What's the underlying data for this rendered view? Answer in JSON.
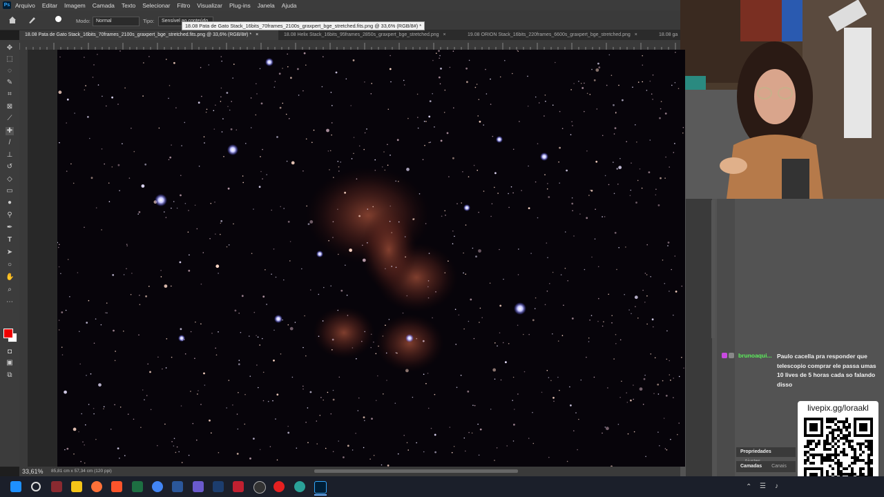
{
  "menubar": {
    "items": [
      "Arquivo",
      "Editar",
      "Imagem",
      "Camada",
      "Texto",
      "Selecionar",
      "Filtro",
      "Visualizar",
      "Plug-ins",
      "Janela",
      "Ajuda"
    ]
  },
  "options": {
    "mode_label": "Modo:",
    "mode_value": "Normal",
    "type_label": "Tipo:",
    "type_value": "Sensível ao conteúdo"
  },
  "tooltip": "18.08 Pata de Gato Stack_16bits_70frames_2100s_graxpert_bge_stretched.fits.png @ 33,6% (RGB/8#) *",
  "tabs": [
    {
      "label": "18.08 Pata de Gato Stack_16bits_70frames_2100s_graxpert_bge_stretched.fits.png @ 33,6% (RGB/8#) *",
      "close": "×",
      "active": true
    },
    {
      "label": "18.08 Helix Stack_16bits_95frames_2850s_graxpert_bge_stretched.png",
      "close": "×",
      "active": false
    },
    {
      "label": "19.08 ORION Stack_16bits_220frames_6600s_graxpert_bge_stretched.png",
      "close": "×",
      "active": false
    },
    {
      "label": "18.08 ga",
      "close": "",
      "active": false
    }
  ],
  "status": {
    "zoom": "33,61%",
    "doc_size": "85,81 cm x 57,34 cm (120 ppi)"
  },
  "chat": {
    "username": "brunoaqui...",
    "message": "Paulo cacella pra responder que telescopio comprar ele passa umas 10 lives de 5 horas cada so falando disso"
  },
  "panels": {
    "props_tab": "Propriedades",
    "adjust_tab": "Ajustes",
    "layers_tab": "Camadas",
    "channels_tab": "Canais"
  },
  "qr": {
    "label": "livepix.gg/loraakl"
  },
  "colors": {
    "foreground": "#e00000",
    "background": "#ffffff",
    "chat_user": "#5cf05c"
  },
  "icons": {
    "toolbar": [
      "move-icon",
      "marquee-icon",
      "lasso-icon",
      "quick-select-icon",
      "crop-icon",
      "frame-icon",
      "eyedropper-icon",
      "healing-icon",
      "brush-icon",
      "clone-stamp-icon",
      "history-brush-icon",
      "eraser-icon",
      "gradient-icon",
      "blur-icon",
      "dodge-icon",
      "pen-icon",
      "type-icon",
      "path-select-icon",
      "shape-icon",
      "hand-icon",
      "zoom-icon",
      "more-icon"
    ]
  }
}
